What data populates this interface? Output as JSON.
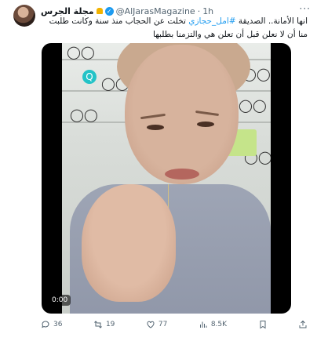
{
  "author": {
    "name": "مجلة الجرس",
    "handle": "@AlJarasMagazine",
    "separator": "·",
    "time": "1h"
  },
  "tweet": {
    "text_before": "انها الأمانة.. الصديقة ",
    "hashtag": "#امل_حجازي",
    "text_after": " تخلت عن الحجاب منذ سنة وكانت طلبت منا أن لا نعلن قبل أن تعلن هي والتزمنا بطلبها"
  },
  "video": {
    "duration": "0:00"
  },
  "actions": {
    "replies": "36",
    "reposts": "19",
    "likes": "77",
    "views": "8.5K"
  },
  "icons": [
    "bell-icon",
    "verified-icon",
    "more-icon",
    "reply-icon",
    "repost-icon",
    "like-icon",
    "views-icon",
    "bookmark-icon",
    "share-icon"
  ],
  "colors": {
    "accent": "#1d9bf0",
    "muted": "#536471"
  }
}
